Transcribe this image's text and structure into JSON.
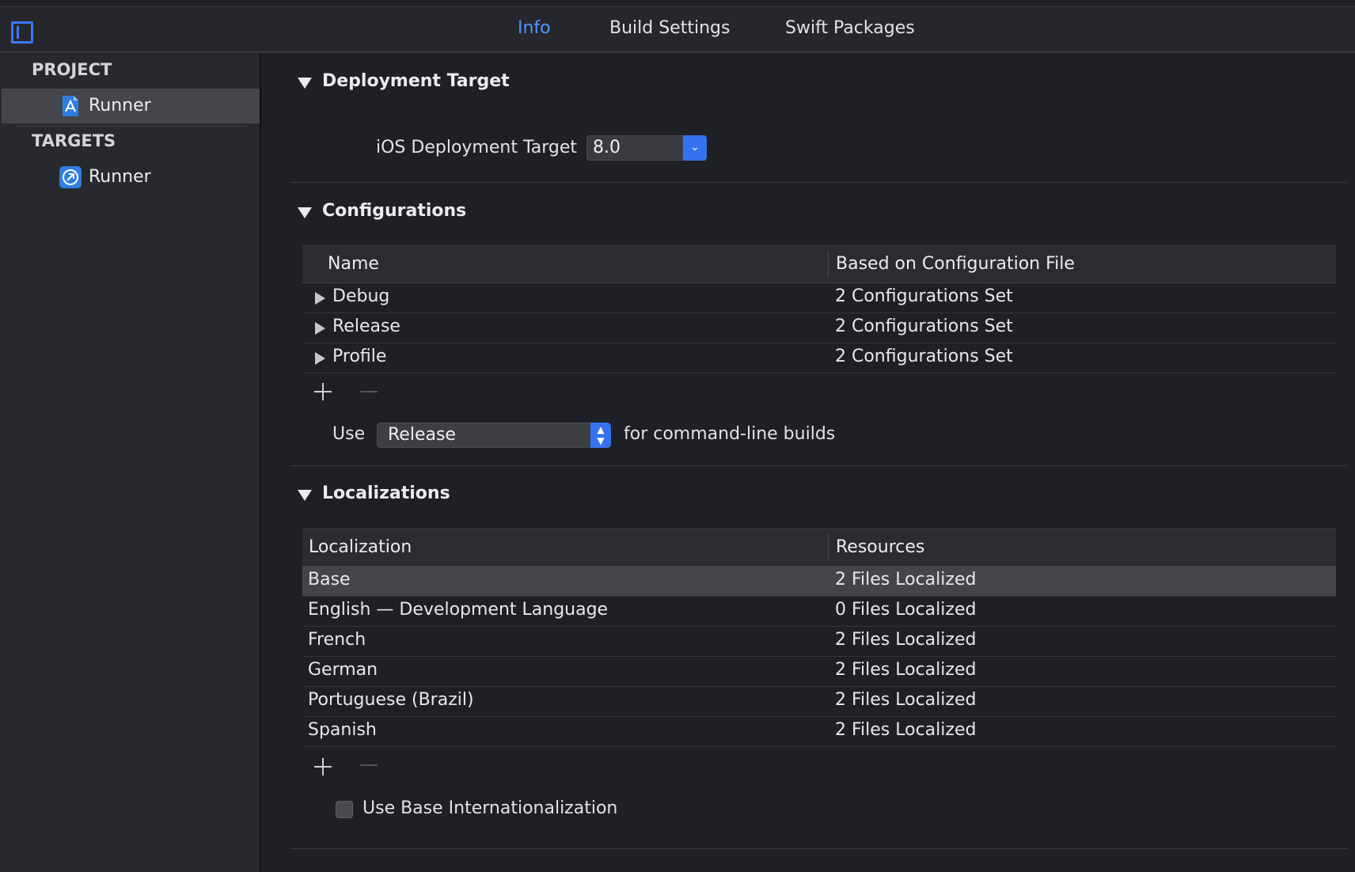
{
  "tabs": [
    {
      "label": "Info",
      "active": true
    },
    {
      "label": "Build Settings",
      "active": false
    },
    {
      "label": "Swift Packages",
      "active": false
    }
  ],
  "sidebar": {
    "project_header": "PROJECT",
    "project_item": "Runner",
    "targets_header": "TARGETS",
    "target_item": "Runner"
  },
  "deployment": {
    "title": "Deployment Target",
    "label": "iOS Deployment Target",
    "value": "8.0"
  },
  "configurations": {
    "title": "Configurations",
    "columns": [
      "Name",
      "Based on Configuration File"
    ],
    "rows": [
      {
        "name": "Debug",
        "file": "2 Configurations Set"
      },
      {
        "name": "Release",
        "file": "2 Configurations Set"
      },
      {
        "name": "Profile",
        "file": "2 Configurations Set"
      }
    ],
    "use_label": "Use",
    "use_value": "Release",
    "use_suffix": "for command-line builds"
  },
  "localizations": {
    "title": "Localizations",
    "columns": [
      "Localization",
      "Resources"
    ],
    "rows": [
      {
        "name": "Base",
        "resources": "2 Files Localized"
      },
      {
        "name": "English — Development Language",
        "resources": "0 Files Localized"
      },
      {
        "name": "French",
        "resources": "2 Files Localized"
      },
      {
        "name": "German",
        "resources": "2 Files Localized"
      },
      {
        "name": "Portuguese (Brazil)",
        "resources": "2 Files Localized"
      },
      {
        "name": "Spanish",
        "resources": "2 Files Localized"
      }
    ],
    "base_internationalization_label": "Use Base Internationalization"
  },
  "colors": {
    "accent": "#3472f0",
    "active_tab": "#4f95ff"
  }
}
